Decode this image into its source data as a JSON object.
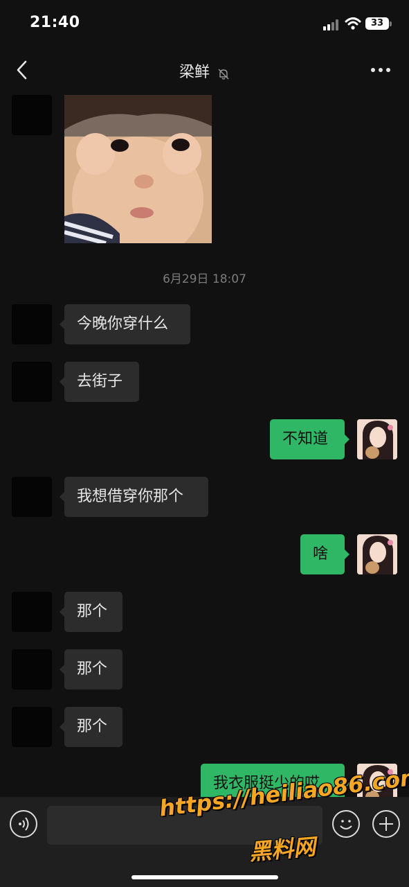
{
  "status_bar": {
    "time": "21:40",
    "battery": "33"
  },
  "nav": {
    "title": "梁鲜"
  },
  "chat": {
    "timestamp": "6月29日 18:07",
    "messages": [
      {
        "from": "them",
        "type": "image",
        "image": "child-photo"
      },
      {
        "from": "them",
        "text": "今晚你穿什么"
      },
      {
        "from": "them",
        "text": "去街子"
      },
      {
        "from": "me",
        "text": "不知道"
      },
      {
        "from": "them",
        "text": "我想借穿你那个"
      },
      {
        "from": "me",
        "text": "啥"
      },
      {
        "from": "them",
        "text": "那个"
      },
      {
        "from": "them",
        "text": "那个"
      },
      {
        "from": "them",
        "text": "那个"
      },
      {
        "from": "me",
        "text": "我衣服挺少的哎"
      }
    ]
  },
  "input_bar": {
    "text": ""
  },
  "watermark": {
    "url": "https://heiliao86.com",
    "name": "黑料网"
  },
  "colors": {
    "background": "#111111",
    "incoming_bubble": "#2c2c2c",
    "outgoing_bubble": "#2fb765"
  }
}
